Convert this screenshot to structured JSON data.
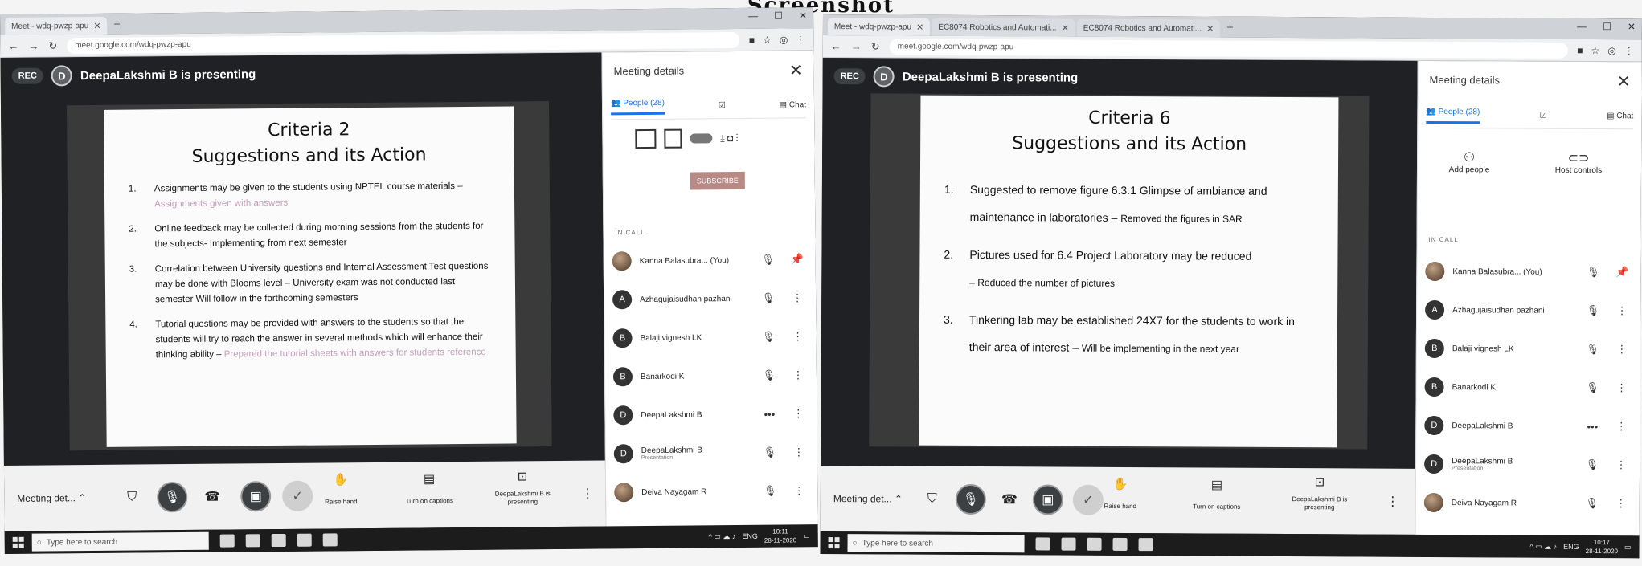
{
  "page_title": "Screenshot",
  "left": {
    "tabs": [
      {
        "label": "Meet - wdq-pwzp-apu"
      }
    ],
    "url": "meet.google.com/wdq-pwzp-apu",
    "rec_label": "REC",
    "presenter_initial": "D",
    "presenting_text": "DeepaLakshmi B is presenting",
    "slide": {
      "title": "Criteria 2",
      "subtitle": "Suggestions and its Action",
      "items": [
        {
          "num": "1.",
          "text": "Assignments may be given to the students using NPTEL course materials –",
          "faded": "Assignments given with answers"
        },
        {
          "num": "2.",
          "text": "Online feedback may be collected during morning sessions from the students for the subjects- Implementing from next semester",
          "faded": ""
        },
        {
          "num": "3.",
          "text": "Correlation between University questions and Internal Assessment Test questions may be done with Blooms level – University exam was not conducted last semester Will follow in the forthcoming semesters",
          "faded": ""
        },
        {
          "num": "4.",
          "text": "Tutorial questions may be provided with answers to the students so that the students will try to reach the answer in several methods which will enhance their thinking ability –",
          "faded": "Prepared the tutorial sheets with answers for students reference"
        }
      ]
    },
    "panel": {
      "title": "Meeting details",
      "people_tab": "People (28)",
      "chat_tab": "Chat",
      "subscribe_label": "SUBSCRIBE",
      "in_call": "IN CALL",
      "people": [
        {
          "initial": "",
          "name": "Kanna Balasubra...",
          "note": "(You)",
          "sub": ""
        },
        {
          "initial": "A",
          "name": "Azhagujaisudhan pazhani",
          "note": "",
          "sub": ""
        },
        {
          "initial": "B",
          "name": "Balaji vignesh LK",
          "note": "",
          "sub": ""
        },
        {
          "initial": "B",
          "name": "Banarkodi K",
          "note": "",
          "sub": ""
        },
        {
          "initial": "D",
          "name": "DeepaLakshmi B",
          "note": "",
          "sub": ""
        },
        {
          "initial": "D",
          "name": "DeepaLakshmi B",
          "note": "",
          "sub": "Presentation"
        },
        {
          "initial": "",
          "name": "Deiva Nayagam R",
          "note": "",
          "sub": ""
        }
      ]
    },
    "controls": {
      "meeting_details": "Meeting det...",
      "raise_hand": "Raise hand",
      "captions": "Turn on captions",
      "presenting": "DeepaLakshmi B is presenting"
    },
    "taskbar": {
      "search_placeholder": "Type here to search",
      "lang": "ENG",
      "time": "10:11",
      "date": "28-11-2020"
    }
  },
  "right": {
    "tabs": [
      {
        "label": "Meet - wdq-pwzp-apu"
      },
      {
        "label": "EC8074 Robotics and Automati..."
      },
      {
        "label": "EC8074 Robotics and Automati..."
      }
    ],
    "url": "meet.google.com/wdq-pwzp-apu",
    "rec_label": "REC",
    "presenter_initial": "D",
    "presenting_text": "DeepaLakshmi B is presenting",
    "slide": {
      "title": "Criteria 6",
      "subtitle": "Suggestions and its Action",
      "items": [
        {
          "num": "1.",
          "text": "Suggested to remove figure 6.3.1 Glimpse of ambiance and maintenance in laboratories –",
          "small": "Removed the figures in SAR"
        },
        {
          "num": "2.",
          "text": "Pictures used for 6.4 Project Laboratory may be reduced",
          "small": "– Reduced the number of pictures"
        },
        {
          "num": "3.",
          "text": "Tinkering lab may be established 24X7 for the students to work in their area of interest –",
          "small": "Will be implementing in the next year"
        }
      ]
    },
    "panel": {
      "title": "Meeting details",
      "people_tab": "People (28)",
      "chat_tab": "Chat",
      "add_people": "Add people",
      "host_controls": "Host controls",
      "in_call": "IN CALL",
      "people": [
        {
          "initial": "",
          "name": "Kanna Balasubra...",
          "note": "(You)",
          "sub": ""
        },
        {
          "initial": "A",
          "name": "Azhagujaisudhan pazhani",
          "note": "",
          "sub": ""
        },
        {
          "initial": "B",
          "name": "Balaji vignesh LK",
          "note": "",
          "sub": ""
        },
        {
          "initial": "B",
          "name": "Banarkodi K",
          "note": "",
          "sub": ""
        },
        {
          "initial": "D",
          "name": "DeepaLakshmi B",
          "note": "",
          "sub": ""
        },
        {
          "initial": "D",
          "name": "DeepaLakshmi B",
          "note": "",
          "sub": "Presentation"
        },
        {
          "initial": "",
          "name": "Deiva Nayagam R",
          "note": "",
          "sub": ""
        }
      ]
    },
    "controls": {
      "meeting_details": "Meeting det...",
      "raise_hand": "Raise hand",
      "captions": "Turn on captions",
      "presenting": "DeepaLakshmi B is presenting"
    },
    "taskbar": {
      "search_placeholder": "Type here to search",
      "lang": "ENG",
      "time": "10:17",
      "date": "28-11-2020"
    }
  }
}
